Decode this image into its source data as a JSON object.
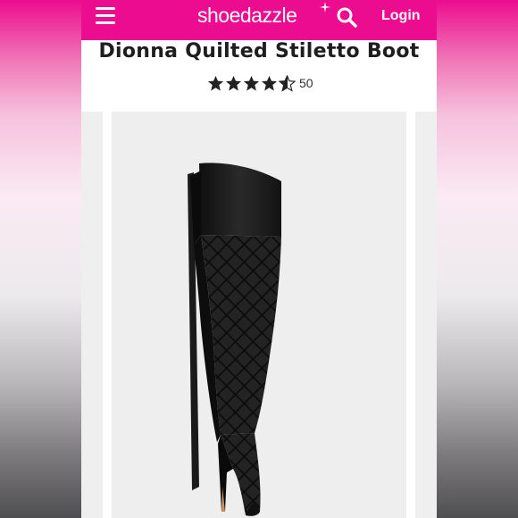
{
  "header": {
    "logo_text": "shoedazzle",
    "login_label": "Login",
    "brand_color": "#ec0c8f",
    "icons": [
      "menu-icon",
      "search-icon"
    ]
  },
  "product": {
    "title": "Dionna Quilted Stiletto Boot",
    "rating_value": 4.5,
    "rating_max": 5,
    "review_count": "50"
  },
  "gallery": {
    "image": "black quilted over-the-knee stiletto boot"
  }
}
